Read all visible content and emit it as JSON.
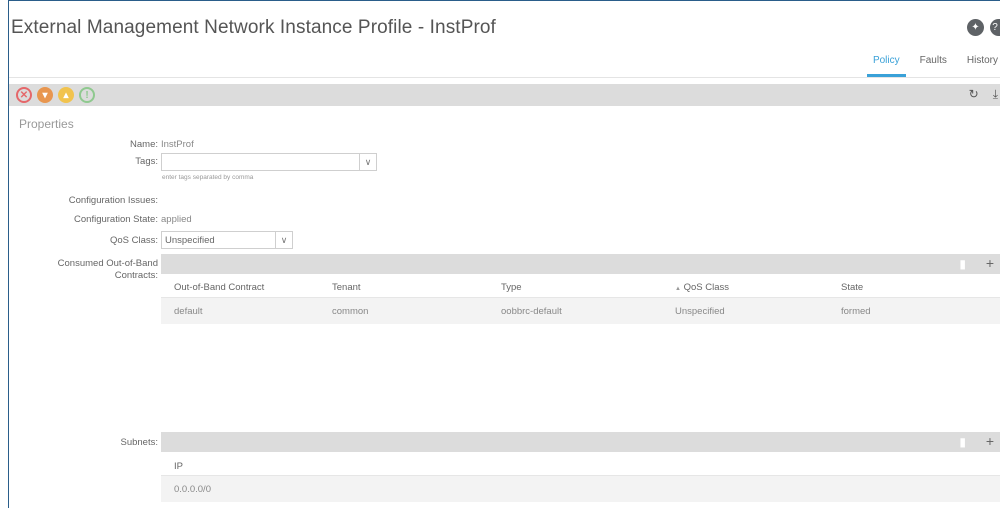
{
  "header": {
    "title": "External Management Network Instance Profile - InstProf"
  },
  "tabs": [
    {
      "label": "Policy",
      "active": true
    },
    {
      "label": "Faults",
      "active": false
    },
    {
      "label": "History",
      "active": false
    }
  ],
  "fault_colors": [
    "#e5676a",
    "#e8964f",
    "#f1c34e",
    "#8fc98f"
  ],
  "properties": {
    "section_title": "Properties",
    "name_label": "Name:",
    "name_value": "InstProf",
    "tags_label": "Tags:",
    "tags_value": "",
    "tags_hint": "enter tags separated by comma",
    "config_issues_label": "Configuration Issues:",
    "config_state_label": "Configuration State:",
    "config_state_value": "applied",
    "qos_label": "QoS Class:",
    "qos_value": "Unspecified"
  },
  "contracts": {
    "label_line1": "Consumed Out-of-Band",
    "label_line2": "Contracts:",
    "columns": [
      "Out-of-Band Contract",
      "Tenant",
      "Type",
      "QoS Class",
      "State"
    ],
    "sort_indicator": "▲",
    "rows": [
      [
        "default",
        "common",
        "oobbrc-default",
        "Unspecified",
        "formed"
      ]
    ]
  },
  "subnets": {
    "label": "Subnets:",
    "columns": [
      "IP"
    ],
    "rows": [
      [
        "0.0.0.0/0"
      ]
    ]
  }
}
